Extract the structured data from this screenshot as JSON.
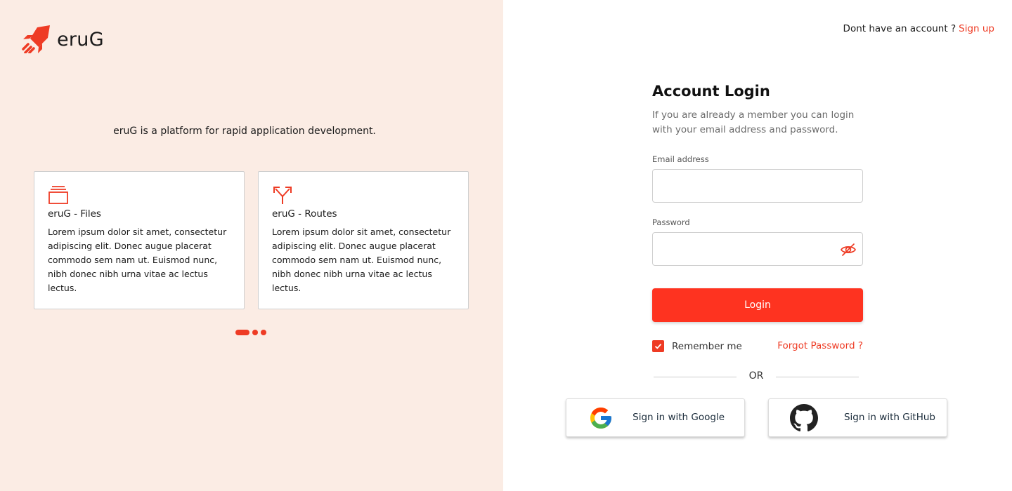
{
  "brand": {
    "name": "eruG",
    "accent": "#ee3b24"
  },
  "left_panel": {
    "tagline": "eruG is a platform for rapid application development.",
    "cards": [
      {
        "icon": "stack-icon",
        "title": "eruG - Files",
        "text": "Lorem ipsum dolor sit amet, consectetur adipiscing elit. Donec augue placerat commodo sem nam ut. Euismod nunc, nibh donec nibh urna vitae ac lectus lectus."
      },
      {
        "icon": "fork-arrows-icon",
        "title": "eruG - Routes",
        "text": "Lorem ipsum dolor sit amet, consectetur adipiscing elit. Donec augue placerat commodo sem nam ut. Euismod nunc, nibh donec nibh urna vitae ac lectus lectus."
      }
    ],
    "carousel": {
      "pages": 3,
      "active": 1
    }
  },
  "header": {
    "signup_prompt": "Dont have an account ?",
    "signup_link": "Sign up"
  },
  "login": {
    "title": "Account Login",
    "subtitle": "If you are already a member you can login with your email address and password.",
    "email_label": "Email address",
    "email_value": "",
    "password_label": "Password",
    "password_value": "",
    "submit_label": "Login",
    "remember_label": "Remember me",
    "remember_checked": true,
    "forgot_label": "Forgot Password ?",
    "divider_label": "OR"
  },
  "social": {
    "google_label": "Sign in with Google",
    "github_label": "Sign in with GitHub"
  }
}
